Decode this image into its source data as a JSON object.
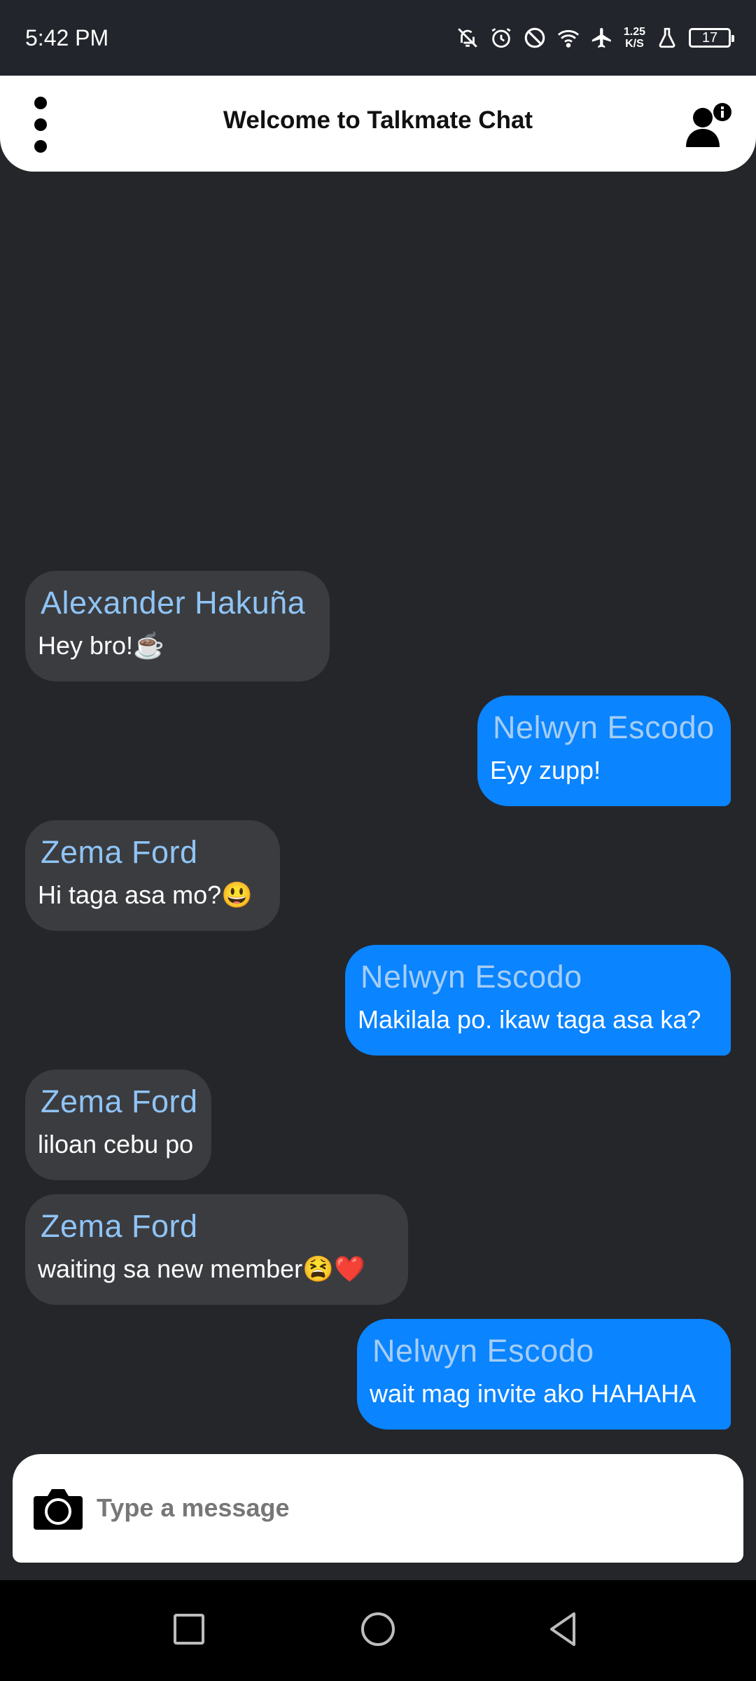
{
  "status_bar": {
    "time": "5:42 PM",
    "net_speed_value": "1.25",
    "net_speed_unit": "K/S",
    "battery": "17",
    "icons": [
      "mute-bell-icon",
      "alarm-icon",
      "do-not-disturb-icon",
      "wifi-icon",
      "airplane-icon",
      "speed-indicator",
      "flask-icon",
      "battery-icon"
    ]
  },
  "header": {
    "title": "Welcome to Talkmate Chat",
    "menu_icon": "more-vertical-icon",
    "user_icon": "user-info-icon"
  },
  "messages": [
    {
      "sender": "Alexander  Hakuña",
      "text": "Hey bro!☕",
      "direction": "incoming"
    },
    {
      "sender": "Nelwyn Escodo",
      "text": "Eyy zupp!",
      "direction": "outgoing"
    },
    {
      "sender": "Zema Ford",
      "text": "Hi taga asa mo?😃",
      "direction": "incoming"
    },
    {
      "sender": "Nelwyn Escodo",
      "text": "Makilala po. ikaw taga asa ka?",
      "direction": "outgoing"
    },
    {
      "sender": "Zema Ford",
      "text": "liloan cebu po",
      "direction": "incoming"
    },
    {
      "sender": "Zema Ford",
      "text": "waiting sa new member😫❤️",
      "direction": "incoming"
    },
    {
      "sender": "Nelwyn Escodo",
      "text": "wait mag invite ako HAHAHA",
      "direction": "outgoing"
    }
  ],
  "input": {
    "placeholder": "Type a message",
    "value": "",
    "camera_icon": "camera-icon"
  },
  "nav_bar": {
    "icons": [
      "recent-apps-icon",
      "home-icon",
      "back-icon"
    ]
  },
  "colors": {
    "background": "#252629",
    "incoming_bubble": "#3b3c40",
    "outgoing_bubble": "#0a84ff",
    "sender_name": "#8fc4f5"
  }
}
